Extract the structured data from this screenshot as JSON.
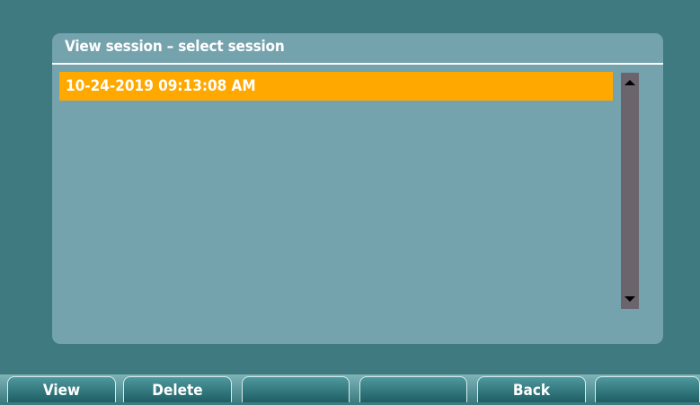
{
  "dialog": {
    "title": "View session – select session",
    "sessions": [
      "10-24-2019 09:13:08 AM"
    ],
    "selected_index": 0
  },
  "softkeys": [
    "View",
    "Delete",
    "",
    "",
    "Back",
    ""
  ],
  "colors": {
    "background": "#3e7a80",
    "panel": "#74a2ad",
    "selection": "#ffa800",
    "scrollbar": "#6b646c"
  }
}
